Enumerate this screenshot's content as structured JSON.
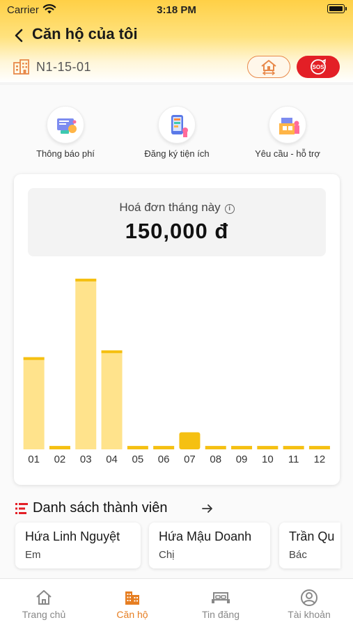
{
  "status_bar": {
    "carrier": "Carrier",
    "time": "3:18 PM"
  },
  "header": {
    "title": "Căn hộ của tôi",
    "apartment_code": "N1-15-01",
    "sos_label": "SOS"
  },
  "quick_actions": [
    {
      "label": "Thông báo phí",
      "icon": "fee-notice-icon"
    },
    {
      "label": "Đăng ký tiện ích",
      "icon": "utility-registration-icon"
    },
    {
      "label": "Yêu cầu - hỗ trợ",
      "icon": "support-request-icon"
    }
  ],
  "invoice": {
    "label": "Hoá đơn tháng này",
    "amount": "150,000 đ"
  },
  "chart_data": {
    "type": "bar",
    "categories": [
      "01",
      "02",
      "03",
      "04",
      "05",
      "06",
      "07",
      "08",
      "09",
      "10",
      "11",
      "12"
    ],
    "values": [
      0.54,
      0.02,
      1.0,
      0.58,
      0.02,
      0.02,
      0.1,
      0.02,
      0.02,
      0.02,
      0.02,
      0.02
    ],
    "highlighted_category": "07",
    "colors": {
      "bar": "#ffe38c",
      "bar_cap": "#f5c012",
      "highlight": "#f5c012"
    }
  },
  "members": {
    "title": "Danh sách thành viên",
    "items": [
      {
        "name": "Hứa Linh Nguyệt",
        "role": "Em"
      },
      {
        "name": "Hứa Mậu Doanh",
        "role": "Chị"
      },
      {
        "name": "Trần Qu",
        "role": "Bác"
      }
    ]
  },
  "tabs": [
    {
      "label": "Trang chủ",
      "icon": "home-icon",
      "active": false
    },
    {
      "label": "Căn hộ",
      "icon": "building-icon",
      "active": true
    },
    {
      "label": "Tin đăng",
      "icon": "bed-icon",
      "active": false
    },
    {
      "label": "Tài khoản",
      "icon": "account-icon",
      "active": false
    }
  ],
  "colors": {
    "accent": "#e67e22",
    "sos": "#e31f26",
    "header_yellow": "#ffd046"
  }
}
